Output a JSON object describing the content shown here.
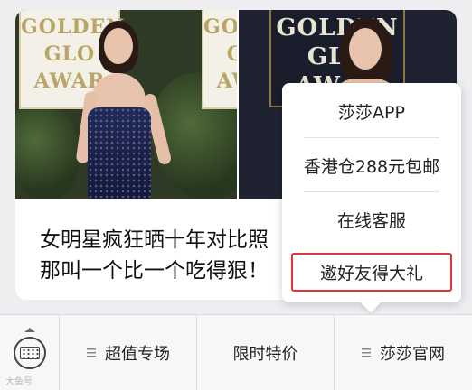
{
  "article": {
    "headline_line1": "女明星疯狂晒十年对比照",
    "headline_line2": "那叫一个比一个吃得狠！",
    "backdrop_left_text": "GOLDEN\nGLO\nAWAR",
    "backdrop_right_text": "GOLDEN\nGLO\nAWAR"
  },
  "popup_menu": {
    "items": [
      {
        "label": "莎莎APP"
      },
      {
        "label": "香港仓288元包邮"
      },
      {
        "label": "在线客服"
      },
      {
        "label": "邀好友得大礼"
      }
    ],
    "highlight_color": "#e2333a"
  },
  "menu_bar": {
    "keyboard_icon": "keyboard-icon",
    "tabs": [
      {
        "label": "超值专场",
        "has_submenu": true
      },
      {
        "label": "限时特价",
        "has_submenu": false
      },
      {
        "label": "莎莎官网",
        "has_submenu": true
      }
    ]
  },
  "watermark": "大鱼号"
}
